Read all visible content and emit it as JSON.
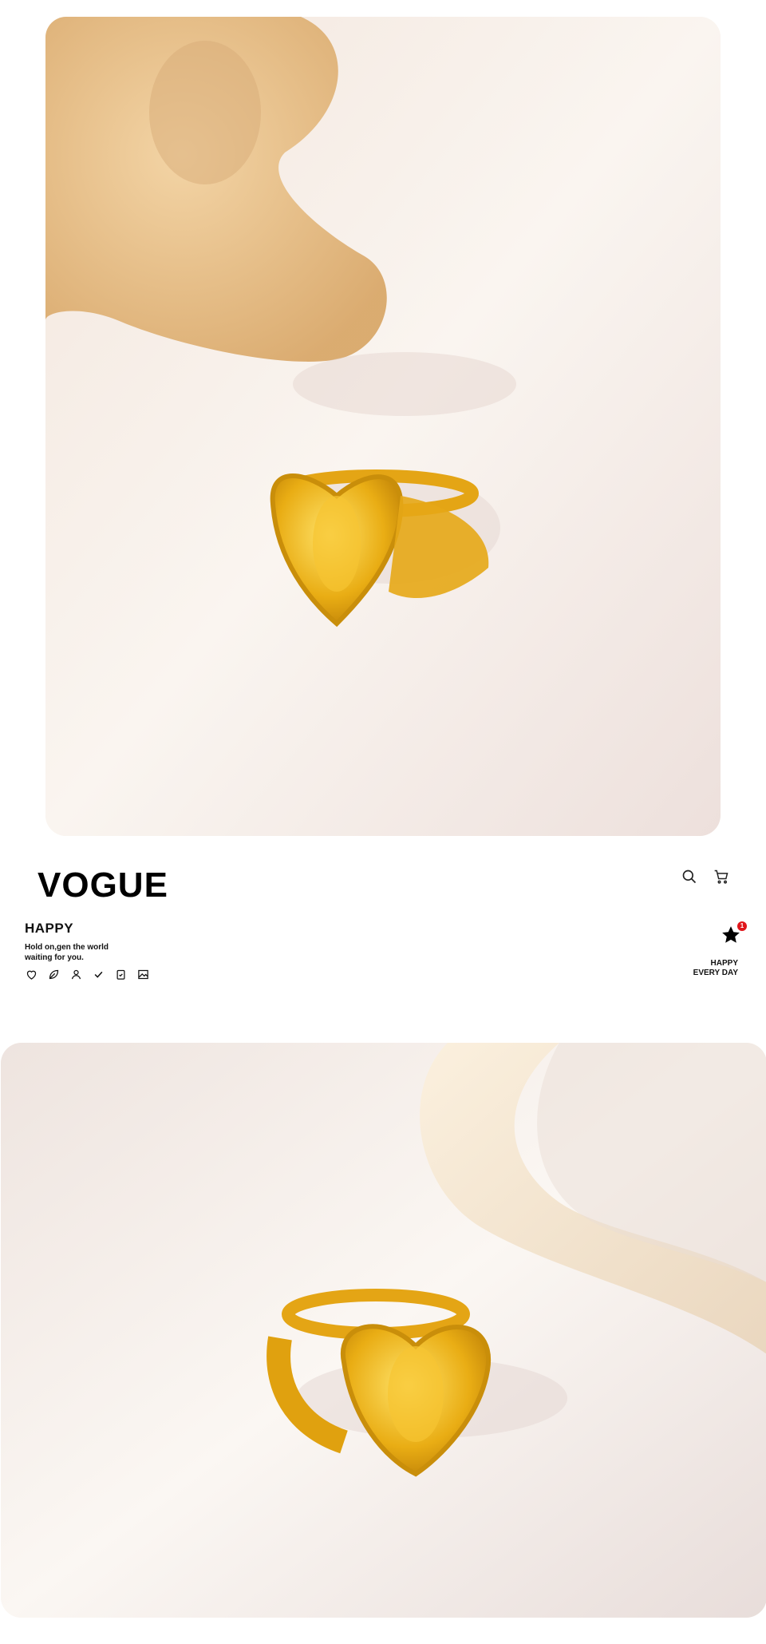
{
  "header": {
    "brand": "VOGUE",
    "icons": [
      "search-icon",
      "cart-icon"
    ]
  },
  "product": {
    "name": "HAPPY",
    "tagline_line1": "Hold on,gen the world",
    "tagline_line2": "waiting for you.",
    "feature_icons": [
      "heart-icon",
      "leaf-icon",
      "user-icon",
      "check-icon",
      "clipboard-check-icon",
      "image-icon"
    ]
  },
  "favorites": {
    "icon": "star-icon",
    "count": "1"
  },
  "slogan": {
    "line1": "HAPPY",
    "line2": "EVERY DAY"
  },
  "images": {
    "top": "gold-heart-angel-ring-with-driftwood",
    "bottom": "gold-heart-angel-ring-with-curved-shape"
  },
  "colors": {
    "badge": "#e0161b",
    "gold": "#e0a10f",
    "background": "#f7efe8"
  }
}
